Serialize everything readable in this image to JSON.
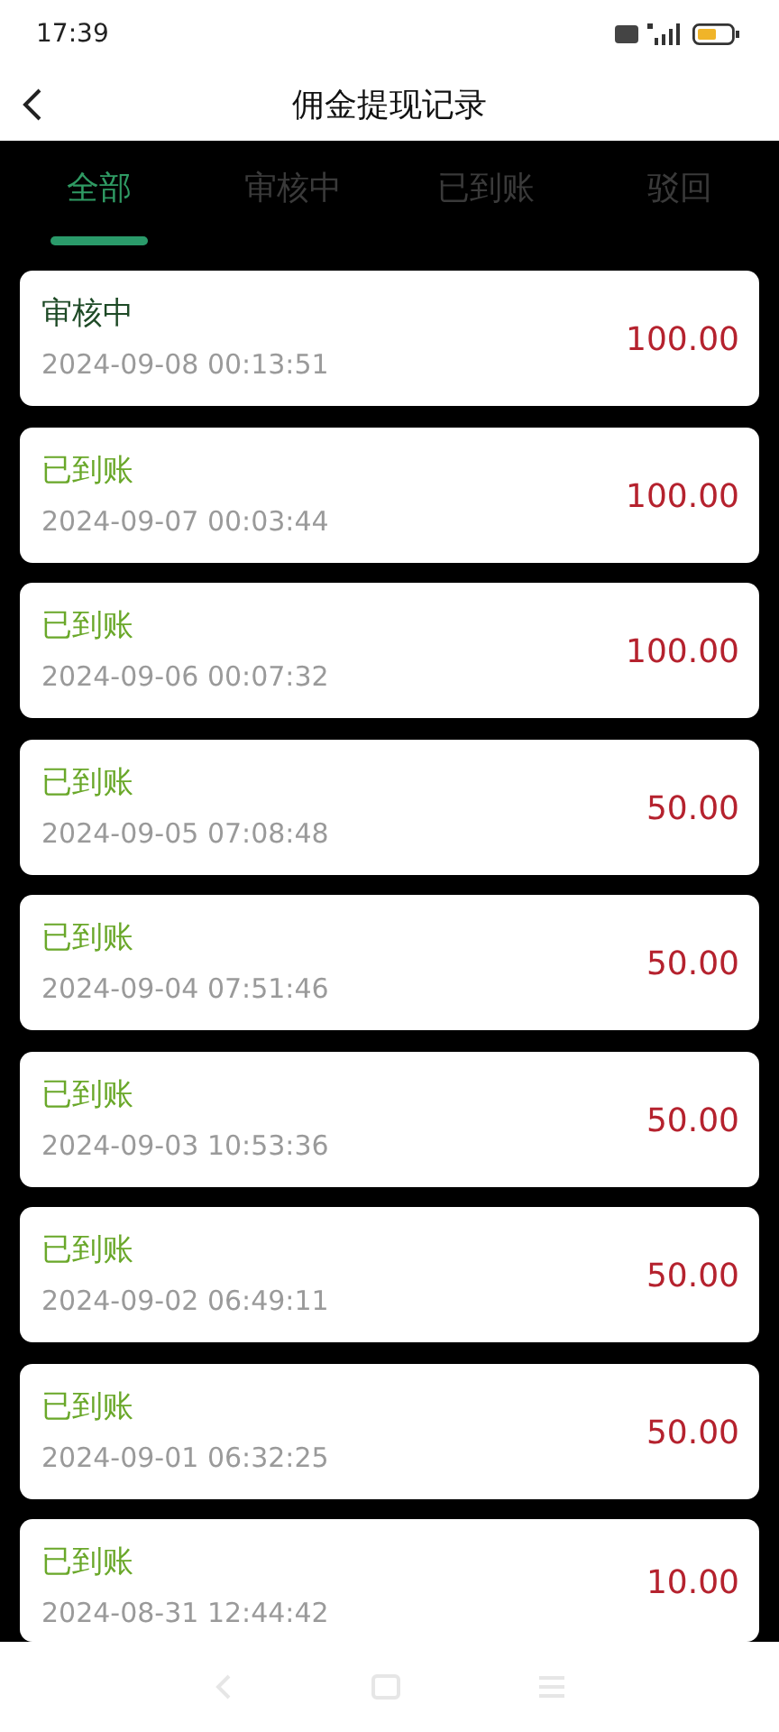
{
  "status_bar": {
    "time": "17:39"
  },
  "header": {
    "title": "佣金提现记录"
  },
  "tabs": [
    {
      "label": "全部",
      "selected": true
    },
    {
      "label": "审核中",
      "selected": false
    },
    {
      "label": "已到账",
      "selected": false
    },
    {
      "label": "驳回",
      "selected": false
    }
  ],
  "records": [
    {
      "status": "审核中",
      "kind": "pending",
      "time": "2024-09-08 00:13:51",
      "amount": "100.00"
    },
    {
      "status": "已到账",
      "kind": "credited",
      "time": "2024-09-07 00:03:44",
      "amount": "100.00"
    },
    {
      "status": "已到账",
      "kind": "credited",
      "time": "2024-09-06 00:07:32",
      "amount": "100.00"
    },
    {
      "status": "已到账",
      "kind": "credited",
      "time": "2024-09-05 07:08:48",
      "amount": "50.00"
    },
    {
      "status": "已到账",
      "kind": "credited",
      "time": "2024-09-04 07:51:46",
      "amount": "50.00"
    },
    {
      "status": "已到账",
      "kind": "credited",
      "time": "2024-09-03 10:53:36",
      "amount": "50.00"
    },
    {
      "status": "已到账",
      "kind": "credited",
      "time": "2024-09-02 06:49:11",
      "amount": "50.00"
    },
    {
      "status": "已到账",
      "kind": "credited",
      "time": "2024-09-01 06:32:25",
      "amount": "50.00"
    },
    {
      "status": "已到账",
      "kind": "credited",
      "time": "2024-08-31 12:44:42",
      "amount": "10.00"
    }
  ]
}
